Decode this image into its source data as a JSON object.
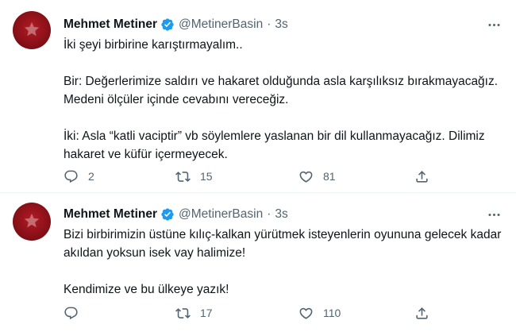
{
  "tweets": [
    {
      "author": "Mehmet Metiner",
      "handle": "@MetinerBasin",
      "separator": "·",
      "time": "3s",
      "paragraphs": [
        "İki şeyi birbirine karıştırmayalım..",
        "Bir: Değerlerimize saldırı ve hakaret olduğunda asla karşılıksız bırakmayacağız. Medeni ölçüler içinde cevabını vereceğiz.",
        "İki: Asla “katli vaciptir” vb söylemlere yaslanan bir dil kullanmayacağız. Dilimiz hakaret ve küfür içermeyecek."
      ],
      "replies": "2",
      "retweets": "15",
      "likes": "81",
      "colors": {
        "verified": "#1d9bf0"
      }
    },
    {
      "author": "Mehmet Metiner",
      "handle": "@MetinerBasin",
      "separator": "·",
      "time": "3s",
      "paragraphs": [
        "Bizi birbirimizin üstüne kılıç-kalkan yürütmek isteyenlerin oyununa gelecek kadar akıldan yoksun isek vay halimize!",
        "Kendimize ve bu ülkeye yazık!"
      ],
      "replies": "",
      "retweets": "17",
      "likes": "110",
      "colors": {
        "verified": "#1d9bf0"
      }
    }
  ],
  "icons": {
    "avatar": "profile-photo",
    "verified": "verified-badge-icon",
    "more": "more-dots-icon",
    "reply": "reply-icon",
    "retweet": "retweet-icon",
    "like": "heart-icon",
    "share": "share-icon"
  },
  "colors": {
    "text": "#0f1419",
    "muted": "#536471",
    "divider": "#eff3f4",
    "avatar": "#8c1119"
  }
}
